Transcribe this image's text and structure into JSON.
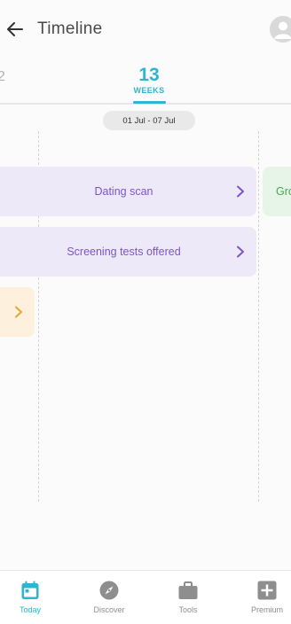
{
  "header": {
    "title": "Timeline",
    "back_icon": "arrow-left-icon",
    "avatar_icon": "user-avatar-icon"
  },
  "week_picker": {
    "previous_partial": "2",
    "current_week": "13",
    "unit": "WEEKS"
  },
  "date_range": "01 Jul - 07 Jul",
  "cards": [
    {
      "label": "Dating scan",
      "color": "#ede9f8",
      "text_color": "#7b55c8"
    },
    {
      "label": "Screening tests offered",
      "color": "#ede9f8",
      "text_color": "#7b55c8"
    },
    {
      "label": "Gro",
      "color": "#e7f5e9",
      "text_color": "#4aa453"
    },
    {
      "label": "",
      "color": "#fdf0dc",
      "text_color": "#f0a235"
    }
  ],
  "bottom_nav": [
    {
      "label": "Today",
      "icon": "calendar-icon",
      "active": true
    },
    {
      "label": "Discover",
      "icon": "compass-icon",
      "active": false
    },
    {
      "label": "Tools",
      "icon": "briefcase-icon",
      "active": false
    },
    {
      "label": "Premium",
      "icon": "plus-box-icon",
      "active": false
    }
  ],
  "colors": {
    "accent": "#2fb5cf",
    "purple_text": "#7b55c8",
    "green_text": "#4aa453",
    "orange_chevron": "#f0a235"
  }
}
